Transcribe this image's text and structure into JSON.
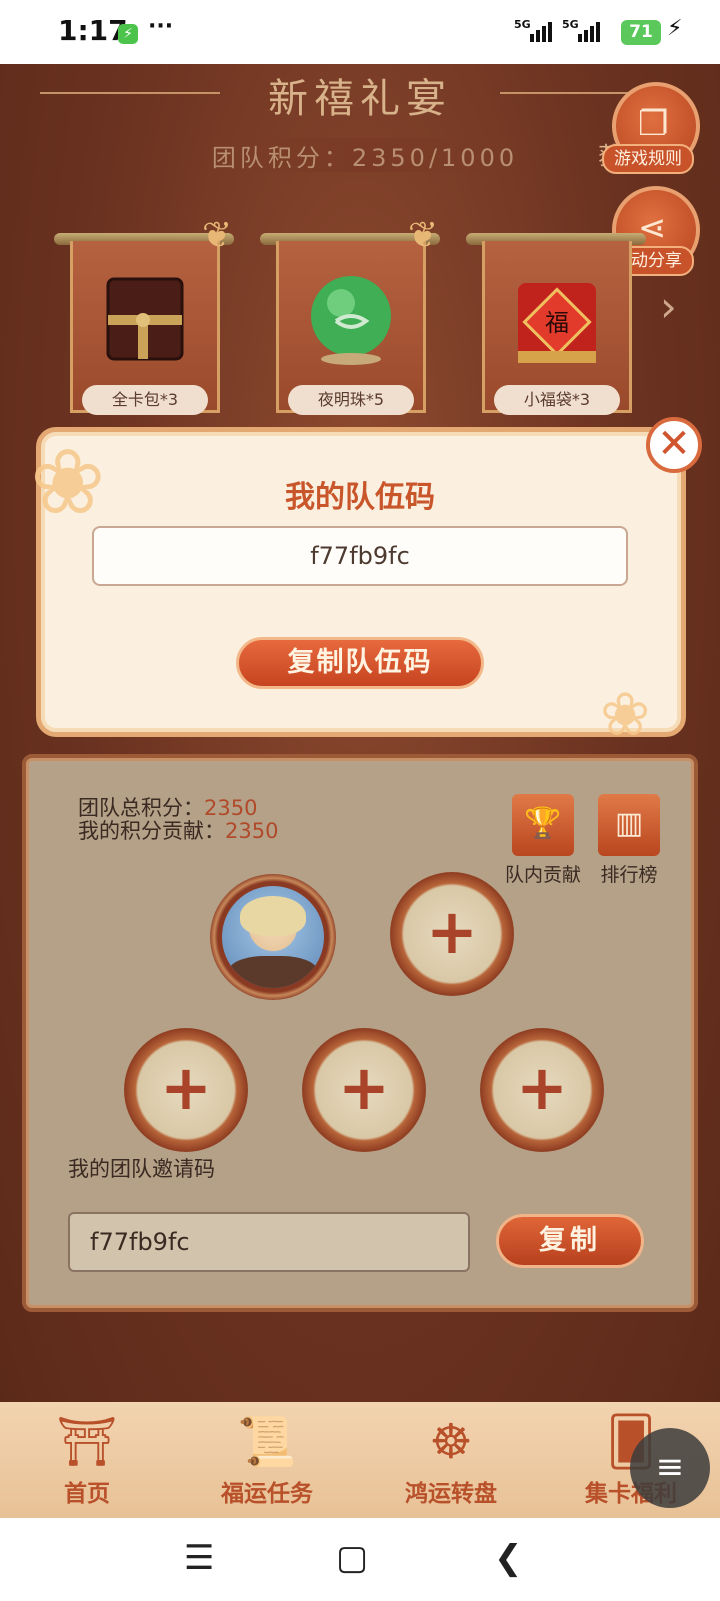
{
  "status_bar": {
    "time": "1:17",
    "dots": "···",
    "net1": "5G",
    "net2": "5G",
    "battery": "71"
  },
  "header": {
    "title": "新禧礼宴",
    "team_score": "团队积分：2350/1000",
    "side_text_partial": "获"
  },
  "side_buttons": {
    "rules_label": "游戏规则",
    "share_label": "活动分享"
  },
  "prizes": [
    {
      "label": "全卡包*3"
    },
    {
      "label": "夜明珠*5"
    },
    {
      "label": "小福袋*3"
    }
  ],
  "modal": {
    "title": "我的队伍码",
    "code": "f77fb9fc",
    "copy_label": "复制队伍码"
  },
  "panel": {
    "total_label": "团队总积分：",
    "total_value": "2350",
    "contrib_label": "我的积分贡献：",
    "contrib_value": "2350",
    "team_contrib_label": "队内贡献",
    "ranking_label": "排行榜",
    "invite_label": "我的团队邀请码",
    "invite_code": "f77fb9fc",
    "copy_label": "复制"
  },
  "bottom_nav": [
    {
      "label": "首页",
      "icon": "pavilion-icon"
    },
    {
      "label": "福运任务",
      "icon": "scroll-icon"
    },
    {
      "label": "鸿运转盘",
      "icon": "wheel-icon"
    },
    {
      "label": "集卡福利",
      "icon": "card-icon"
    }
  ],
  "colors": {
    "accent": "#c9552b",
    "panel_bg": "#b4a188",
    "modal_bg": "#fbf0df",
    "nav_bg": "#f2d4b0"
  }
}
